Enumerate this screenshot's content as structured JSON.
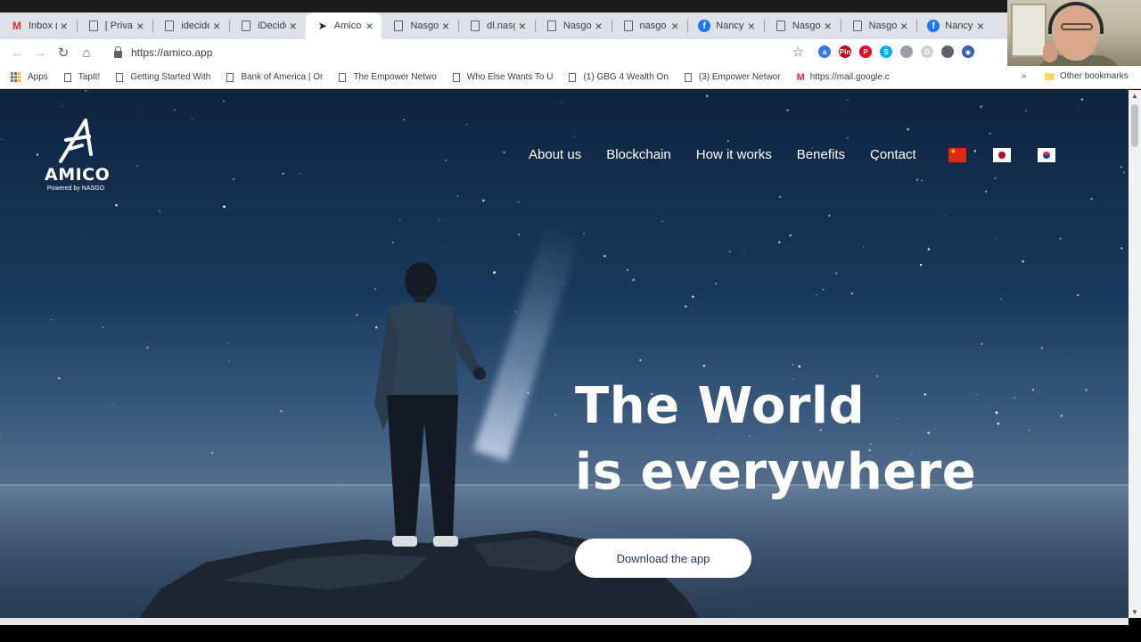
{
  "browser": {
    "tabs": [
      {
        "title": "Inbox (",
        "favicon": "gmail-icon",
        "active": false
      },
      {
        "title": "[ Privat",
        "favicon": "document-icon",
        "active": false
      },
      {
        "title": "idecide",
        "favicon": "document-icon",
        "active": false
      },
      {
        "title": "iDecide",
        "favicon": "document-icon",
        "active": false
      },
      {
        "title": "Amico",
        "favicon": "amico-icon",
        "active": true
      },
      {
        "title": "Nasgo",
        "favicon": "document-icon",
        "active": false
      },
      {
        "title": "dl.nasg",
        "favicon": "document-icon",
        "active": false
      },
      {
        "title": "Nasgo",
        "favicon": "document-icon",
        "active": false
      },
      {
        "title": "nasgo",
        "favicon": "document-icon",
        "active": false
      },
      {
        "title": "Nancy",
        "favicon": "facebook-icon",
        "active": false
      },
      {
        "title": "Nasgo",
        "favicon": "document-icon",
        "active": false
      },
      {
        "title": "Nasgo",
        "favicon": "document-icon",
        "active": false
      },
      {
        "title": "Nancy",
        "favicon": "facebook-icon",
        "active": false
      }
    ],
    "url": "https://amico.app",
    "extensions": [
      {
        "name": "amazon-extension-icon",
        "color": "#3b78e7",
        "glyph": "a"
      },
      {
        "name": "pinterest-save-extension-icon",
        "color": "#bd081c",
        "glyph": "Pin"
      },
      {
        "name": "pinterest-extension-icon",
        "color": "#e60023",
        "glyph": "P"
      },
      {
        "name": "skype-extension-icon",
        "color": "#00aff0",
        "glyph": "S"
      },
      {
        "name": "grey-circle-extension-icon",
        "color": "#9aa0a6",
        "glyph": ""
      },
      {
        "name": "google-extension-icon",
        "color": "#cfd2d6",
        "glyph": "G"
      },
      {
        "name": "shield-extension-icon",
        "color": "#5f6368",
        "glyph": ""
      },
      {
        "name": "ethereum-extension-icon",
        "color": "#3c5fb8",
        "glyph": "◆"
      }
    ],
    "bookmarks": [
      {
        "label": "Apps",
        "icon": "apps-grid-icon"
      },
      {
        "label": "TapIt!",
        "icon": "document-icon"
      },
      {
        "label": "Getting Started With",
        "icon": "document-icon"
      },
      {
        "label": "Bank of America | Or",
        "icon": "document-icon"
      },
      {
        "label": "The Empower Netwo",
        "icon": "document-icon"
      },
      {
        "label": "Who Else Wants To U",
        "icon": "document-icon"
      },
      {
        "label": "(1) GBG 4 Wealth On",
        "icon": "document-icon"
      },
      {
        "label": "(3) Empower Networ",
        "icon": "document-icon"
      },
      {
        "label": "https://mail.google.c",
        "icon": "gmail-icon"
      }
    ],
    "bookmarks_overflow": "»",
    "other_bookmarks": "Other bookmarks"
  },
  "site": {
    "logo_name": "AMICO",
    "logo_sub": "Powered by NASGO",
    "nav": [
      "About us",
      "Blockchain",
      "How it works",
      "Benefits",
      "Contact"
    ],
    "languages": [
      "chinese-flag-icon",
      "japanese-flag-icon",
      "korean-flag-icon"
    ],
    "hero_line1": "The World",
    "hero_line2": "is everywhere",
    "cta": "Download the app",
    "cta_text_color": "#1f3b68"
  }
}
